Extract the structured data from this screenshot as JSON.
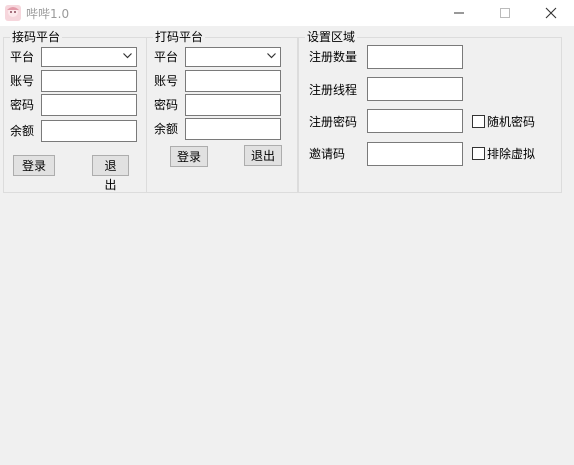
{
  "window": {
    "title": "哔哔1.0"
  },
  "receive_group": {
    "legend": "接码平台",
    "platform_label": "平台",
    "account_label": "账号",
    "password_label": "密码",
    "balance_label": "余额",
    "platform_value": "",
    "account_value": "",
    "password_value": "",
    "balance_value": "",
    "login_label": "登录",
    "logout_label": "退出"
  },
  "captcha_group": {
    "legend": "打码平台",
    "platform_label": "平台",
    "account_label": "账号",
    "password_label": "密码",
    "balance_label": "余额",
    "platform_value": "",
    "account_value": "",
    "password_value": "",
    "balance_value": "",
    "login_label": "登录",
    "logout_label": "退出"
  },
  "settings_group": {
    "legend": "设置区域",
    "reg_count_label": "注册数量",
    "reg_threads_label": "注册线程",
    "reg_password_label": "注册密码",
    "invite_code_label": "邀请码",
    "reg_count_value": "",
    "reg_threads_value": "",
    "reg_password_value": "",
    "invite_code_value": "",
    "random_password_label": "随机密码",
    "exclude_virtual_label": "排除虚拟",
    "random_password_checked": false,
    "exclude_virtual_checked": false
  }
}
